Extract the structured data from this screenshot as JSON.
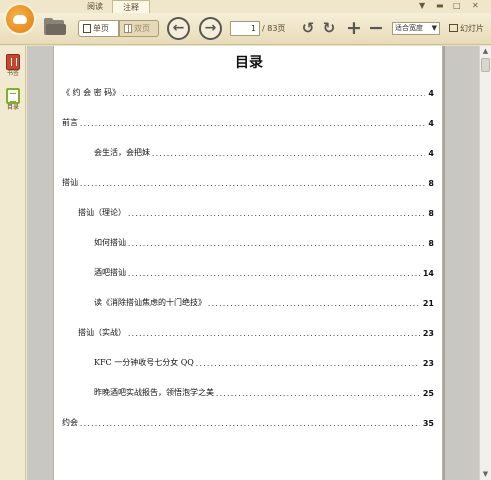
{
  "tabs": [
    {
      "label": "阅读"
    },
    {
      "label": "注释"
    }
  ],
  "window_controls": {
    "menu": "▼",
    "minimize": "▬",
    "maximize": "□",
    "close": "✕"
  },
  "toolbar": {
    "single_page": "单页",
    "double_page": "双页",
    "prev": "←",
    "next": "→",
    "page_current": "1",
    "page_total": "/ 83页",
    "rotate_left": "↺",
    "rotate_right": "↻",
    "zoom_in": "+",
    "zoom_out": "−",
    "fit_select": "适合宽度",
    "slideshow": "幻灯片"
  },
  "sidebar": {
    "items": [
      {
        "label": "书签"
      },
      {
        "label": "目录"
      }
    ]
  },
  "document": {
    "title": "目录",
    "toc": [
      {
        "text": "《 约 会 密 码》",
        "page": "4"
      },
      {
        "text": "前言",
        "page": "4"
      },
      {
        "text": "会生活，会把妹",
        "page": "4"
      },
      {
        "text": "搭讪",
        "page": "8"
      },
      {
        "text": "搭讪（理论）",
        "page": "8"
      },
      {
        "text": "如何搭讪",
        "page": "8"
      },
      {
        "text": "酒吧搭讪",
        "page": "14"
      },
      {
        "text": "读《消除搭讪焦虑的十门绝技》",
        "page": "21"
      },
      {
        "text": "搭讪（实战）",
        "page": "23"
      },
      {
        "text": "KFC 一分钟收号七分女 QQ",
        "page": "23"
      },
      {
        "text": "昨晚酒吧实战报告，领悟泡学之美",
        "page": "25"
      },
      {
        "text": "约会",
        "page": "35"
      }
    ]
  },
  "scrollbar": {
    "up": "▲",
    "down": "▼"
  },
  "colors": {
    "toolbar_bg": "#efe6cb",
    "accent_orange": "#e07d12",
    "bookmark_red": "#c7462d",
    "toc_green": "#7fb027"
  }
}
